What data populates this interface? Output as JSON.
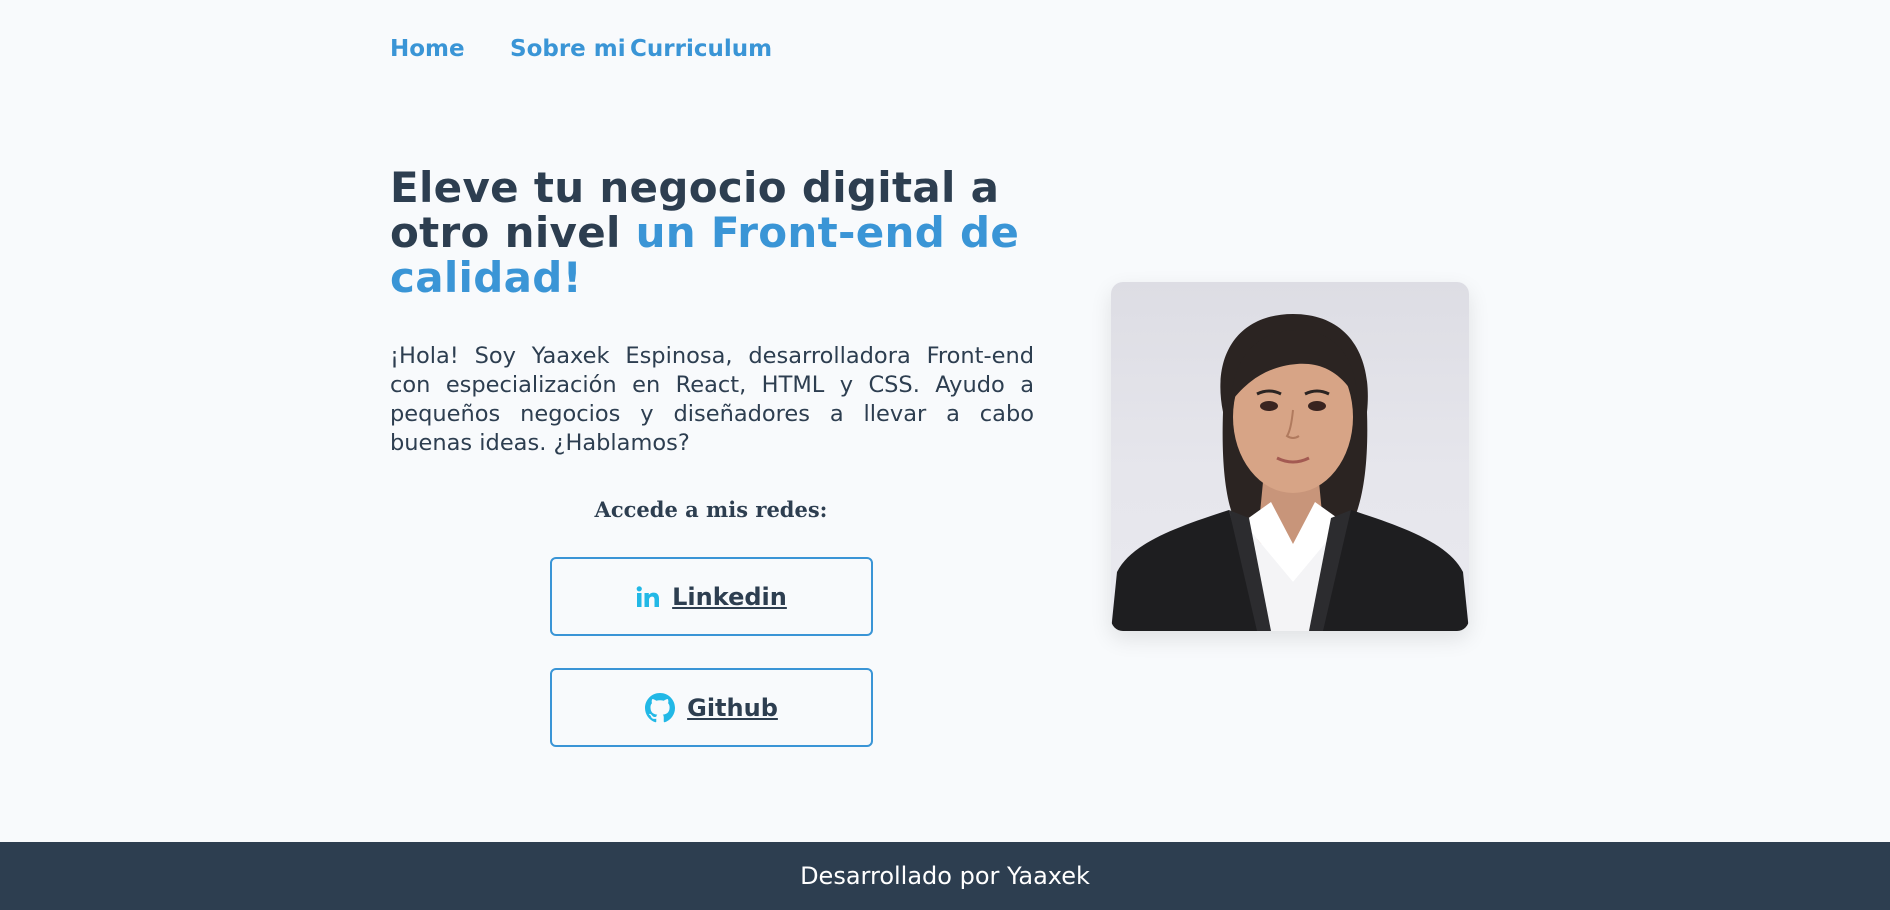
{
  "nav": {
    "items": [
      {
        "label": "Home"
      },
      {
        "label": "Sobre mi"
      },
      {
        "label": "Curriculum"
      }
    ]
  },
  "hero": {
    "title_part1": "Eleve tu negocio digital a otro nivel ",
    "title_accent": "un Front-end de calidad!",
    "intro": "¡Hola! Soy Yaaxek Espinosa, desarrolladora Front-end con especialización en React, HTML y CSS. Ayudo a pequeños negocios y diseñadores a llevar a cabo buenas ideas. ¿Hablamos?"
  },
  "social": {
    "heading": "Accede a mis redes:",
    "linkedin_label": "Linkedin",
    "github_label": "Github",
    "linkedin_icon": "linkedin-icon",
    "github_icon": "github-icon"
  },
  "colors": {
    "accent": "#3a95d6",
    "dark": "#2d3e50",
    "icon": "#22b8e6",
    "background": "#f8fafc"
  },
  "footer": {
    "text": "Desarrollado por Yaaxek"
  }
}
